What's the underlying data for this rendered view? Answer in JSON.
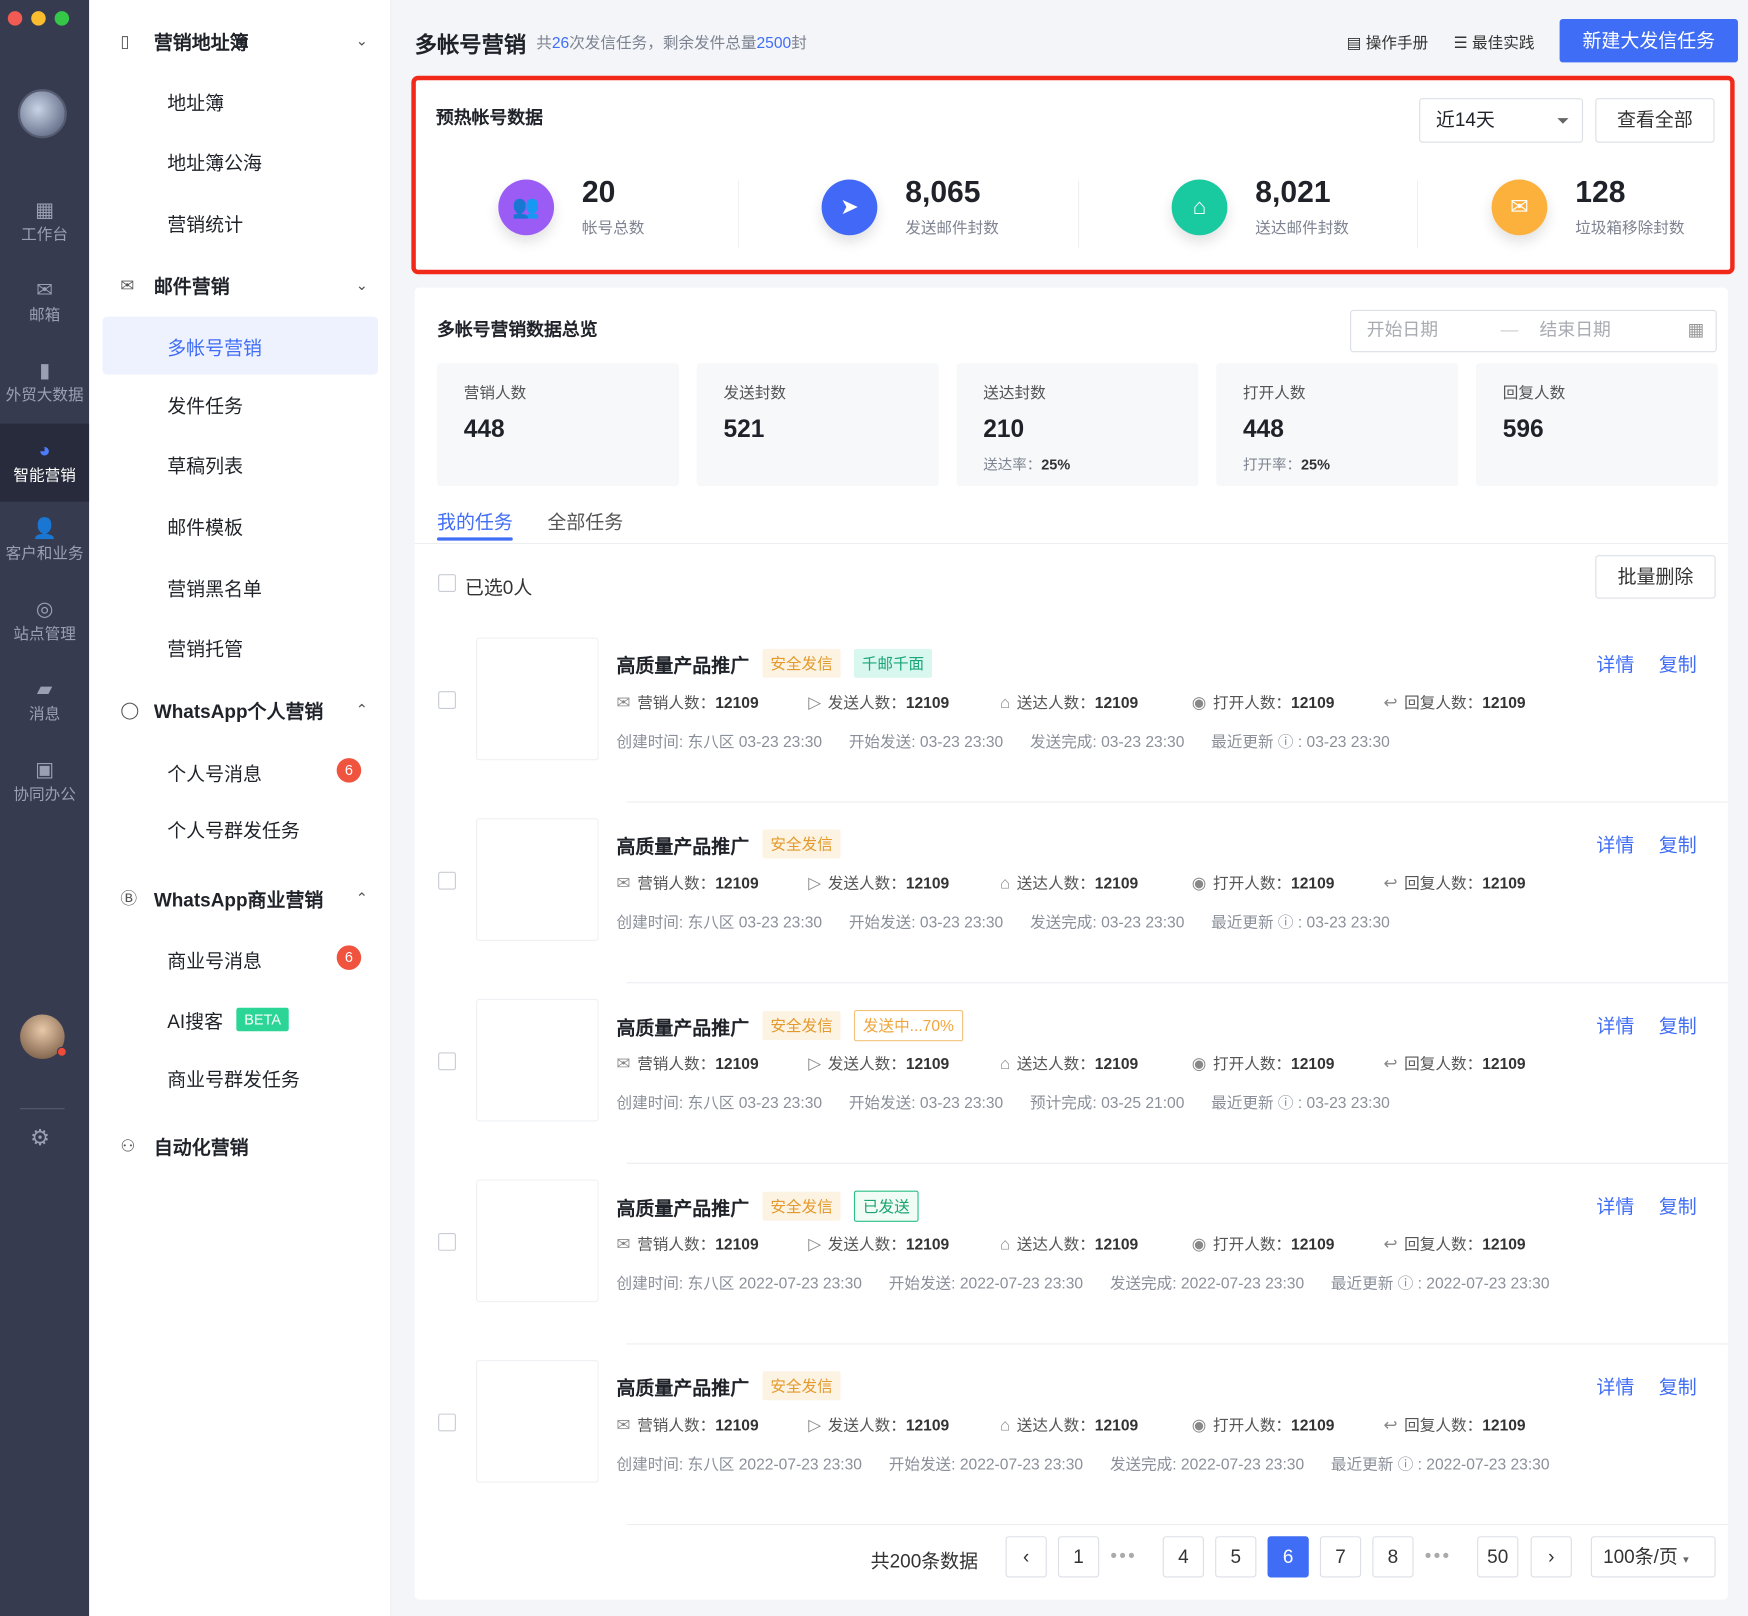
{
  "window": {
    "controls": [
      "#f25b53",
      "#f9bd2f",
      "#34c748"
    ]
  },
  "rail": {
    "items": [
      {
        "label": "工作台",
        "icon": "grid-icon"
      },
      {
        "label": "邮箱",
        "icon": "mail-icon"
      },
      {
        "label": "外贸大数据",
        "icon": "bar-chart-icon"
      },
      {
        "label": "智能营销",
        "icon": "pie-chart-icon",
        "active": true
      },
      {
        "label": "客户和业务",
        "icon": "user-icon"
      },
      {
        "label": "站点管理",
        "icon": "globe-icon"
      },
      {
        "label": "消息",
        "icon": "chat-icon"
      },
      {
        "label": "协同办公",
        "icon": "monitor-icon"
      }
    ]
  },
  "sidebar": {
    "addr_group": "营销地址簿",
    "addr_items": [
      "地址簿",
      "地址簿公海",
      "营销统计"
    ],
    "mail_group": "邮件营销",
    "mail_items": [
      "多帐号营销",
      "发件任务",
      "草稿列表",
      "邮件模板",
      "营销黑名单",
      "营销托管"
    ],
    "wa_personal": "WhatsApp个人营销",
    "wa_personal_items": [
      "个人号消息",
      "个人号群发任务"
    ],
    "wa_personal_badge": "6",
    "wa_business": "WhatsApp商业营销",
    "wa_business_items": [
      "商业号消息",
      "AI搜客",
      "商业号群发任务"
    ],
    "wa_business_badge": "6",
    "beta": "BETA",
    "auto": "自动化营销"
  },
  "header": {
    "title": "多帐号营销",
    "sub_pre": "共",
    "tasks": "26",
    "sub_mid": "次发信任务，剩余发件总量",
    "remain": "2500",
    "sub_post": "封",
    "manual": "操作手册",
    "best": "最佳实践",
    "new_task": "新建大发信任务"
  },
  "warmup": {
    "title": "预热帐号数据",
    "range": "近14天",
    "view_all": "查看全部",
    "stats": [
      {
        "value": "20",
        "label": "帐号总数",
        "color": "#9b5cf6"
      },
      {
        "value": "8,065",
        "label": "发送邮件封数",
        "color": "#4168f6"
      },
      {
        "value": "8,021",
        "label": "送达邮件封数",
        "color": "#19c9a0"
      },
      {
        "value": "128",
        "label": "垃圾箱移除封数",
        "color": "#fbb13c"
      }
    ]
  },
  "overview": {
    "title": "多帐号营销数据总览",
    "start_ph": "开始日期",
    "end_ph": "结束日期",
    "kpis": [
      {
        "label": "营销人数",
        "value": "448"
      },
      {
        "label": "发送封数",
        "value": "521"
      },
      {
        "label": "送达封数",
        "value": "210",
        "rate_label": "送达率：",
        "rate": "25%"
      },
      {
        "label": "打开人数",
        "value": "448",
        "rate_label": "打开率：",
        "rate": "25%"
      },
      {
        "label": "回复人数",
        "value": "596"
      }
    ]
  },
  "tabs": [
    "我的任务",
    "全部任务"
  ],
  "list": {
    "selected": "已选0人",
    "bulk_delete": "批量删除",
    "detail": "详情",
    "copy": "复制",
    "metric_labels": [
      "营销人数：",
      "发送人数：",
      "送达人数：",
      "打开人数：",
      "回复人数："
    ],
    "rows": [
      {
        "name": "高质量产品推广",
        "tags": [
          {
            "t": "安全发信",
            "k": "safe"
          },
          {
            "t": "千邮千面",
            "k": "qy"
          }
        ],
        "metrics": [
          "12109",
          "12109",
          "12109",
          "12109",
          "12109"
        ],
        "times": [
          "创建时间: 东八区 03-23 23:30",
          "开始发送: 03-23 23:30",
          "发送完成: 03-23 23:30",
          "最近更新 ⓘ : 03-23 23:30"
        ]
      },
      {
        "name": "高质量产品推广",
        "tags": [
          {
            "t": "安全发信",
            "k": "safe"
          }
        ],
        "metrics": [
          "12109",
          "12109",
          "12109",
          "12109",
          "12109"
        ],
        "times": [
          "创建时间: 东八区 03-23 23:30",
          "开始发送: 03-23 23:30",
          "发送完成: 03-23 23:30",
          "最近更新 ⓘ : 03-23 23:30"
        ]
      },
      {
        "name": "高质量产品推广",
        "tags": [
          {
            "t": "安全发信",
            "k": "safe"
          },
          {
            "t": "发送中...70%",
            "k": "sending"
          }
        ],
        "metrics": [
          "12109",
          "12109",
          "12109",
          "12109",
          "12109"
        ],
        "times": [
          "创建时间: 东八区 03-23 23:30",
          "开始发送: 03-23 23:30",
          "预计完成: 03-25 21:00",
          "最近更新 ⓘ : 03-23 23:30"
        ]
      },
      {
        "name": "高质量产品推广",
        "tags": [
          {
            "t": "安全发信",
            "k": "safe"
          },
          {
            "t": "已发送",
            "k": "sent"
          }
        ],
        "metrics": [
          "12109",
          "12109",
          "12109",
          "12109",
          "12109"
        ],
        "times": [
          "创建时间: 东八区 2022-07-23 23:30",
          "开始发送: 2022-07-23 23:30",
          "发送完成: 2022-07-23 23:30",
          "最近更新 ⓘ : 2022-07-23 23:30"
        ]
      },
      {
        "name": "高质量产品推广",
        "tags": [
          {
            "t": "安全发信",
            "k": "safe"
          }
        ],
        "metrics": [
          "12109",
          "12109",
          "12109",
          "12109",
          "12109"
        ],
        "times": [
          "创建时间: 东八区 2022-07-23 23:30",
          "开始发送: 2022-07-23 23:30",
          "发送完成: 2022-07-23 23:30",
          "最近更新 ⓘ : 2022-07-23 23:30"
        ]
      }
    ]
  },
  "pagination": {
    "total": "共200条数据",
    "pages": [
      "1",
      "•••",
      "4",
      "5",
      "6",
      "7",
      "8",
      "•••",
      "50"
    ],
    "current": "6",
    "per_page": "100条/页"
  }
}
